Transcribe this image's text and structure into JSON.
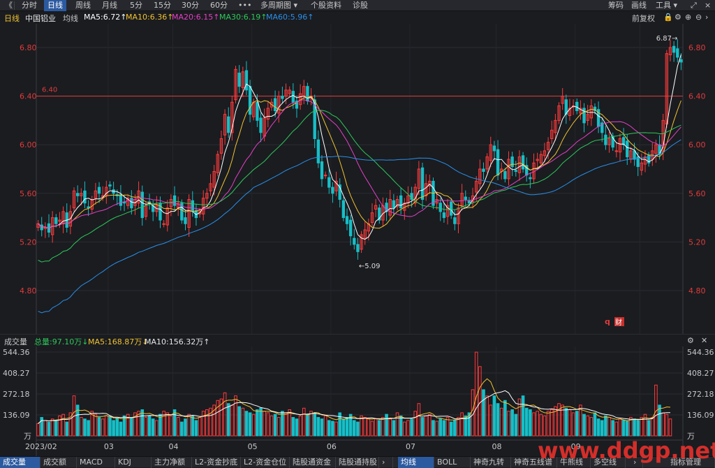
{
  "topbar": {
    "nav_back": "《",
    "tabs": [
      "分时",
      "日线",
      "周线",
      "月线",
      "5分",
      "15分",
      "30分",
      "60分",
      "•••",
      "多周期图 ▾",
      "个股资料",
      "诊股"
    ],
    "active_tab": "日线",
    "right_items": [
      "筹码",
      "画线",
      "工具 ▾"
    ],
    "window_icons": [
      "⤢",
      "×"
    ]
  },
  "info": {
    "period": "日线",
    "stock_name": "中国铝业",
    "ma_label": "均线",
    "ma5": "MA5:6.72↑",
    "ma10": "MA10:6.36↑",
    "ma20": "MA20:6.15↑",
    "ma30": "MA30:6.19↑",
    "ma60": "MA60:5.96↑",
    "adjust": "前复权",
    "adjust_icons": [
      "lock-icon",
      "settings-icon",
      "zoom-in-icon",
      "zoom-out-icon"
    ]
  },
  "price_axis": {
    "ticks": [
      "6.80",
      "6.40",
      "6.00",
      "5.60",
      "5.20",
      "4.80"
    ]
  },
  "annotations": {
    "hline": "6.40",
    "high": "6.87→",
    "low": "←5.09",
    "logo": "财"
  },
  "vol_header": {
    "label": "成交量",
    "total": "总量:97.10万↓",
    "ma5": "MA5:168.87万↓",
    "ma10": "MA10:156.32万↑"
  },
  "vol_axis": {
    "ticks": [
      "544.36",
      "408.27",
      "272.18",
      "136.09"
    ],
    "unit": "万"
  },
  "x_axis": {
    "labels": [
      "2023/02",
      "03",
      "04",
      "05",
      "06",
      "07",
      "08",
      "09"
    ]
  },
  "bottombar": {
    "left_tabs": [
      "成交量",
      "成交额",
      "MACD",
      "KDJ",
      "主力净额",
      "L2-资金抄底",
      "L2-资金仓位",
      "陆股通资金",
      "陆股通持股"
    ],
    "right_tabs": [
      "均线",
      "BOLL",
      "神奇九转",
      "神奇五线谱",
      "牛熊线",
      "多空线"
    ],
    "right_end": "指标管理",
    "watermark": "www.ddgp.net"
  },
  "colors": {
    "up": "#ff3b3b",
    "down": "#17bfc7",
    "ma5": "#ffffff",
    "ma10": "#f2c230",
    "ma20": "#e83fc8",
    "ma30": "#2fc85a",
    "ma60": "#2a8fe8"
  },
  "chart_data": {
    "type": "candlestick",
    "title": "中国铝业 日线",
    "ylim": [
      4.6,
      6.95
    ],
    "dates_start": "2023/02",
    "closes": [
      5.35,
      5.3,
      5.32,
      5.28,
      5.4,
      5.35,
      5.38,
      5.45,
      5.32,
      5.45,
      5.62,
      5.58,
      5.6,
      5.52,
      5.48,
      5.55,
      5.62,
      5.6,
      5.58,
      5.65,
      5.66,
      5.6,
      5.58,
      5.5,
      5.52,
      5.56,
      5.48,
      5.55,
      5.62,
      5.4,
      5.5,
      5.52,
      5.45,
      5.5,
      5.38,
      5.35,
      5.48,
      5.55,
      5.5,
      5.52,
      5.38,
      5.35,
      5.55,
      5.45,
      5.4,
      5.45,
      5.56,
      5.6,
      5.68,
      5.78,
      5.92,
      6.05,
      6.25,
      6.1,
      6.35,
      6.62,
      6.48,
      6.6,
      6.45,
      6.25,
      6.35,
      6.2,
      6.1,
      6.22,
      6.3,
      6.35,
      6.28,
      6.4,
      6.38,
      6.45,
      6.45,
      6.35,
      6.3,
      6.42,
      6.48,
      6.36,
      6.4,
      6.05,
      5.85,
      5.72,
      5.75,
      5.65,
      5.6,
      5.7,
      5.55,
      5.4,
      5.35,
      5.25,
      5.18,
      5.12,
      5.26,
      5.3,
      5.35,
      5.44,
      5.5,
      5.38,
      5.5,
      5.45,
      5.55,
      5.48,
      5.55,
      5.48,
      5.52,
      5.58,
      5.55,
      5.65,
      5.8,
      5.55,
      5.68,
      5.7,
      5.5,
      5.55,
      5.45,
      5.4,
      5.5,
      5.42,
      5.35,
      5.48,
      5.6,
      5.55,
      5.52,
      5.58,
      5.7,
      5.8,
      5.78,
      5.9,
      6.0,
      5.95,
      5.75,
      5.8,
      5.72,
      5.88,
      5.82,
      5.78,
      5.9,
      5.8,
      5.75,
      5.72,
      5.85,
      5.88,
      5.92,
      5.95,
      6.02,
      6.12,
      6.2,
      6.32,
      6.4,
      6.25,
      6.3,
      6.32,
      6.28,
      6.3,
      6.18,
      6.25,
      6.32,
      6.28,
      6.15,
      6.1,
      6.0,
      6.05,
      5.98,
      5.95,
      6.05,
      6.0,
      5.9,
      5.95,
      5.88,
      5.82,
      5.85,
      5.9,
      5.85,
      5.95,
      6.0,
      5.92,
      6.2,
      6.75,
      6.8,
      6.76,
      6.72,
      6.68
    ],
    "volume_unit": "万",
    "volume_ylim": [
      0,
      544.36
    ],
    "volumes": [
      80,
      120,
      100,
      90,
      110,
      95,
      130,
      140,
      90,
      150,
      260,
      200,
      120,
      110,
      100,
      160,
      140,
      120,
      110,
      130,
      125,
      100,
      115,
      90,
      130,
      140,
      120,
      150,
      160,
      170,
      120,
      130,
      110,
      100,
      140,
      160,
      150,
      130,
      170,
      120,
      90,
      110,
      140,
      130,
      100,
      120,
      160,
      170,
      180,
      200,
      230,
      240,
      280,
      210,
      200,
      260,
      190,
      180,
      160,
      150,
      140,
      170,
      180,
      160,
      150,
      130,
      140,
      120,
      160,
      150,
      170,
      120,
      110,
      130,
      180,
      140,
      160,
      150,
      120,
      110,
      130,
      100,
      95,
      90,
      150,
      110,
      120,
      140,
      100,
      90,
      130,
      120,
      110,
      95,
      110,
      100,
      120,
      140,
      110,
      100,
      150,
      130,
      90,
      100,
      110,
      160,
      210,
      120,
      130,
      140,
      100,
      95,
      110,
      100,
      120,
      90,
      100,
      120,
      150,
      130,
      150,
      300,
      544,
      450,
      300,
      260,
      200,
      260,
      210,
      180,
      230,
      160,
      170,
      140,
      240,
      260,
      180,
      170,
      150,
      160,
      140,
      130,
      160,
      170,
      190,
      210,
      200,
      180,
      170,
      150,
      160,
      200,
      140,
      130,
      120,
      150,
      110,
      100,
      130,
      120,
      100,
      90,
      110,
      100,
      95,
      120,
      110,
      100,
      120,
      140,
      100,
      120,
      330,
      200,
      150,
      140,
      110
    ]
  }
}
